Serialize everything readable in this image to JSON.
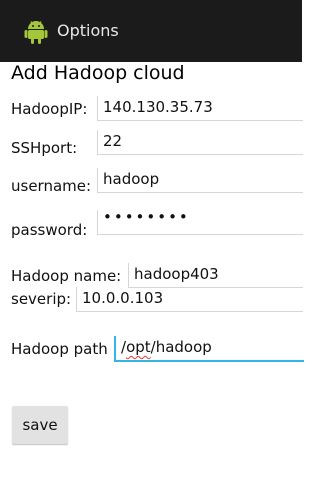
{
  "titlebar": {
    "title": "Options",
    "icon": "android-icon"
  },
  "form": {
    "heading": "Add Hadoop cloud",
    "hadoop_ip_label": "HadoopIP:",
    "hadoop_ip_value": "140.130.35.73",
    "ssh_port_label": "SSHport:",
    "ssh_port_value": "22",
    "username_label": "username:",
    "username_value": "hadoop",
    "password_label": "password:",
    "password_value": "••••••••",
    "hadoop_name_label": "Hadoop name:",
    "hadoop_name_value": "hadoop403",
    "sever_ip_label": "severip:",
    "sever_ip_value": "10.0.0.103",
    "hadoop_path_label": "Hadoop path",
    "hadoop_path_prefix": "/",
    "hadoop_path_misspelled": "opt",
    "hadoop_path_suffix": "/hadoop"
  },
  "actions": {
    "save_label": "save"
  },
  "colors": {
    "accent": "#33b5e5",
    "titlebar": "#1b1b1b",
    "android_green": "#a4c639"
  }
}
